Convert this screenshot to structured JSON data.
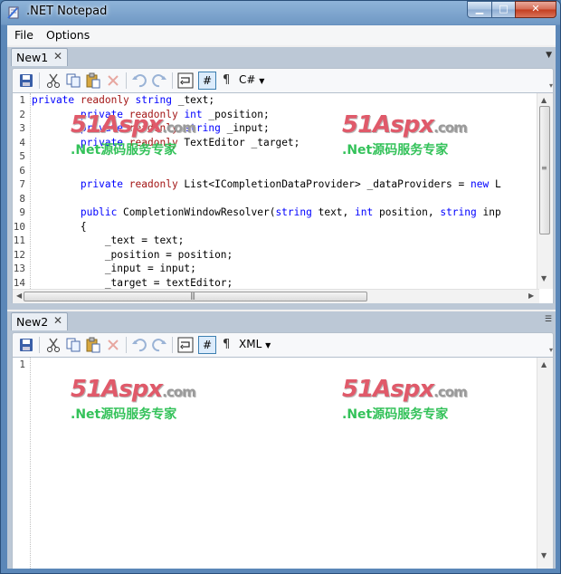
{
  "window": {
    "title": ".NET Notepad"
  },
  "menu": {
    "file": "File",
    "options": "Options"
  },
  "panes": [
    {
      "tab": "New1",
      "language": "C#",
      "line_numbers": [
        "1",
        "2",
        "3",
        "4",
        "5",
        "6",
        "7",
        "8",
        "9",
        "10",
        "11",
        "12",
        "13",
        "14"
      ],
      "code_lines": [
        [
          [
            "kw",
            "private"
          ],
          [
            "t",
            " "
          ],
          [
            "mod",
            "readonly"
          ],
          [
            "t",
            " "
          ],
          [
            "kw",
            "string"
          ],
          [
            "t",
            " _text;"
          ]
        ],
        [
          [
            "t",
            "        "
          ],
          [
            "kw",
            "private"
          ],
          [
            "t",
            " "
          ],
          [
            "mod",
            "readonly"
          ],
          [
            "t",
            " "
          ],
          [
            "kw",
            "int"
          ],
          [
            "t",
            " _position;"
          ]
        ],
        [
          [
            "t",
            "        "
          ],
          [
            "kw",
            "private"
          ],
          [
            "t",
            " "
          ],
          [
            "mod",
            "readonly"
          ],
          [
            "t",
            " "
          ],
          [
            "kw",
            "string"
          ],
          [
            "t",
            " _input;"
          ]
        ],
        [
          [
            "t",
            "        "
          ],
          [
            "kw",
            "private"
          ],
          [
            "t",
            " "
          ],
          [
            "mod",
            "readonly"
          ],
          [
            "t",
            " TextEditor _target;"
          ]
        ],
        [
          [
            "t",
            ""
          ]
        ],
        [
          [
            "t",
            ""
          ]
        ],
        [
          [
            "t",
            "        "
          ],
          [
            "kw",
            "private"
          ],
          [
            "t",
            " "
          ],
          [
            "mod",
            "readonly"
          ],
          [
            "t",
            " List<ICompletionDataProvider> _dataProviders = "
          ],
          [
            "kw",
            "new"
          ],
          [
            "t",
            " L"
          ]
        ],
        [
          [
            "t",
            ""
          ]
        ],
        [
          [
            "t",
            "        "
          ],
          [
            "kw",
            "public"
          ],
          [
            "t",
            " CompletionWindowResolver("
          ],
          [
            "kw",
            "string"
          ],
          [
            "t",
            " text, "
          ],
          [
            "kw",
            "int"
          ],
          [
            "t",
            " position, "
          ],
          [
            "kw",
            "string"
          ],
          [
            "t",
            " inp"
          ]
        ],
        [
          [
            "t",
            "        {"
          ]
        ],
        [
          [
            "t",
            "            _text = text;"
          ]
        ],
        [
          [
            "t",
            "            _position = position;"
          ]
        ],
        [
          [
            "t",
            "            _input = input;"
          ]
        ],
        [
          [
            "t",
            "            _target = textEditor;"
          ]
        ]
      ]
    },
    {
      "tab": "New2",
      "language": "XML",
      "line_numbers": [
        "1"
      ],
      "code_lines": [
        [
          [
            "t",
            ""
          ]
        ]
      ]
    }
  ],
  "toolbar": {
    "icons": [
      "save-icon",
      "cut-icon",
      "copy-icon",
      "paste-icon",
      "delete-icon",
      "undo-icon",
      "redo-icon",
      "word-wrap-icon",
      "line-numbers-icon",
      "show-whitespace-icon"
    ],
    "line_numbers_glyph": "#",
    "whitespace_glyph": "¶"
  },
  "watermark": {
    "logo": "51Aspx",
    "domain": ".com",
    "tagline": ".Net源码服务专家"
  },
  "colors": {
    "keyword": "#0000ff",
    "modifier": "#a31515",
    "watermark_red": "#e05a6a",
    "watermark_green": "#34c25a"
  }
}
